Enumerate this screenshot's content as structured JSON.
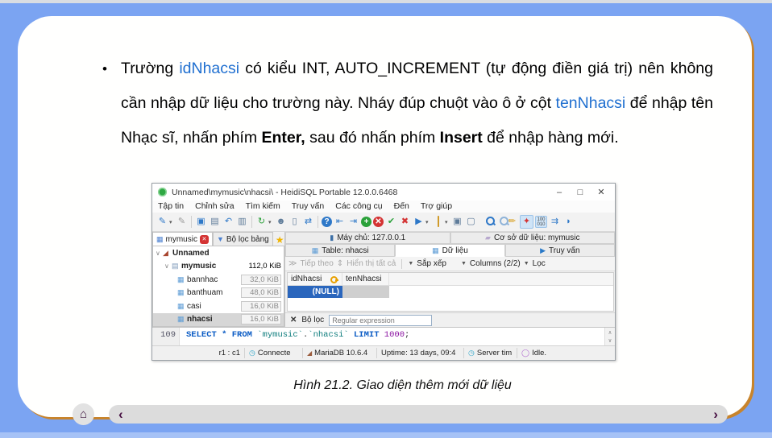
{
  "slide": {
    "bullet": {
      "marker": "•",
      "seg1": "Trường ",
      "link1": "idNhacsi",
      "seg2": " có kiểu INT, AUTO_INCREMENT (tự động điền giá trị) nên không cần nhập dữ liệu cho trường này. Nháy đúp chuột vào ô ở cột ",
      "link2": "tenNhacsi",
      "seg3": " để nhập tên Nhạc sĩ, nhấn phím ",
      "bold1": "Enter,",
      "seg4": " sau đó nhấn phím ",
      "bold2": "Insert",
      "seg5": " để nhập hàng mới."
    },
    "caption": "Hình 21.2. Giao diện thêm mới dữ liệu",
    "nav": {
      "home": "⌂",
      "prev": "‹",
      "next": "›"
    },
    "colors": {
      "background": "#7ba4f2",
      "card_border": "#c8842c",
      "link": "#1f6fd0"
    }
  },
  "app": {
    "title": "Unnamed\\mymusic\\nhacsi\\ - HeidiSQL Portable 12.0.0.6468",
    "window_controls": {
      "minimize": "–",
      "maximize": "□",
      "close": "✕"
    },
    "menu": [
      "Tập tin",
      "Chỉnh sửa",
      "Tìm kiếm",
      "Truy vấn",
      "Các công cụ",
      "Đến",
      "Trợ giúp"
    ],
    "toolbar": {
      "caret": "▾",
      "icons": [
        {
          "n": "session-manager-icon",
          "g": "✎"
        },
        {
          "n": "disconnect-icon",
          "g": "✎"
        },
        {
          "n": "copy-icon",
          "g": "▣"
        },
        {
          "n": "paste-icon",
          "g": "▤"
        },
        {
          "n": "undo-icon",
          "g": "↶"
        },
        {
          "n": "print-icon",
          "g": "▥"
        },
        {
          "n": "refresh-icon",
          "g": "↻"
        },
        {
          "n": "user-manager-icon",
          "g": "☻"
        },
        {
          "n": "export-icon",
          "g": "▯"
        },
        {
          "n": "sync-icon",
          "g": "⇄"
        },
        {
          "n": "help-icon",
          "g": "?"
        },
        {
          "n": "first-record-icon",
          "g": "⇤"
        },
        {
          "n": "last-record-icon",
          "g": "⇥"
        },
        {
          "n": "insert-row-icon",
          "g": "+"
        },
        {
          "n": "cancel-icon",
          "g": "✕"
        },
        {
          "n": "post-icon",
          "g": "✔"
        },
        {
          "n": "discard-icon",
          "g": "✖"
        },
        {
          "n": "run-icon",
          "g": "▶"
        },
        {
          "n": "folder-icon",
          "g": ""
        },
        {
          "n": "save-icon",
          "g": "▣"
        },
        {
          "n": "monitor-icon",
          "g": "▢"
        },
        {
          "n": "search-icon",
          "g": ""
        },
        {
          "n": "find-text-icon",
          "g": ""
        },
        {
          "n": "clean-icon",
          "g": "✏"
        },
        {
          "n": "highlight-icon",
          "g": "✦"
        },
        {
          "n": "binary-icon",
          "g": "100 010"
        },
        {
          "n": "reformat-icon",
          "g": "⇉"
        },
        {
          "n": "edge-icon",
          "g": "◗"
        }
      ]
    },
    "session_tabs": {
      "tab1": "mymusic",
      "tab1_close": "✕",
      "tab2": "Bộ lọc bảng",
      "star": "★"
    },
    "tree": {
      "rows": [
        {
          "expander": "∨",
          "label": "Unnamed",
          "size": ""
        },
        {
          "expander": "∨",
          "label": "mymusic",
          "size": "112,0 KiB"
        },
        {
          "expander": "",
          "label": "bannhac",
          "size": "32,0 KiB"
        },
        {
          "expander": "",
          "label": "banthuam",
          "size": "48,0 KiB"
        },
        {
          "expander": "",
          "label": "casi",
          "size": "16,0 KiB"
        },
        {
          "expander": "",
          "label": "nhacsi",
          "size": "16,0 KiB"
        }
      ]
    },
    "main_tabs": {
      "host": "Máy chủ: 127.0.0.1",
      "database": "Cơ sở dữ liệu: mymusic",
      "table": "Table: nhacsi",
      "data": "Dữ liệu",
      "query": "Truy vấn"
    },
    "data_toolbar": {
      "next_icon": "≫",
      "next": "Tiếp theo",
      "showall_icon": "⇕",
      "showall": "Hiển thị tất cả",
      "dd": "▼",
      "sort": "Sắp xếp",
      "columns": "Columns (2/2)",
      "filter": "Lọc"
    },
    "grid": {
      "col1": "idNhacsi",
      "col2": "tenNhacsi",
      "row1_col1": "(NULL)"
    },
    "filter_bar": {
      "close": "✕",
      "label": "Bộ lọc",
      "placeholder": "Regular expression"
    },
    "sql": {
      "line_number": "109",
      "tokens": [
        {
          "t": "SELECT "
        },
        {
          "t": "* "
        },
        {
          "t": "FROM "
        },
        {
          "t": "`mymusic`"
        },
        {
          "t": "."
        },
        {
          "t": "`nhacsi`"
        },
        {
          "t": " LIMIT "
        },
        {
          "t": "1000"
        },
        {
          "t": ";"
        }
      ]
    },
    "scroll": {
      "up": "∧",
      "down": "∨"
    },
    "status": [
      {
        "icon": "",
        "text": "r1 : c1"
      },
      {
        "icon": "◷",
        "text": "Connecte"
      },
      {
        "icon": "◢",
        "text": "MariaDB 10.6.4"
      },
      {
        "icon": "",
        "text": "Uptime: 13 days, 09:4"
      },
      {
        "icon": "◷",
        "text": "Server tim"
      },
      {
        "icon": "◯",
        "text": "Idle."
      }
    ]
  }
}
